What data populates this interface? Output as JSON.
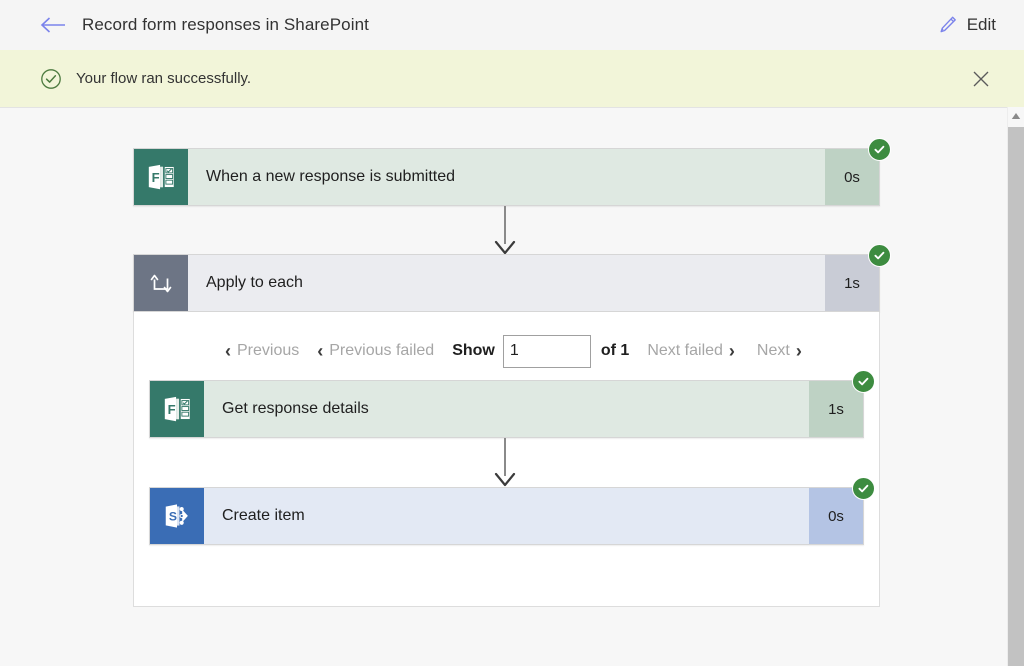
{
  "header": {
    "back_icon": "arrow-left-icon",
    "title": "Record form responses in SharePoint",
    "edit_icon": "pencil-icon",
    "edit_label": "Edit",
    "accent_color": "#7b83eb"
  },
  "banner": {
    "status_icon": "check-circle-icon",
    "message": "Your flow ran successfully.",
    "close_icon": "close-icon",
    "background_color": "#f2f5d9",
    "icon_color": "#4c7a3f"
  },
  "flow": {
    "success_badge_icon": "check-badge-icon",
    "success_badge_color": "#3d8c40",
    "steps": [
      {
        "name": "trigger-step",
        "icon": "microsoft-forms-icon",
        "label": "When a new response is submitted",
        "duration": "0s",
        "status": "succeeded",
        "theme_color": "#35796a"
      },
      {
        "name": "apply-to-each-step",
        "icon": "loop-icon",
        "label": "Apply to each",
        "duration": "1s",
        "status": "succeeded",
        "theme_color": "#6d7585"
      },
      {
        "name": "get-response-details-step",
        "icon": "microsoft-forms-icon",
        "label": "Get response details",
        "duration": "1s",
        "status": "succeeded",
        "theme_color": "#35796a"
      },
      {
        "name": "create-item-step",
        "icon": "sharepoint-icon",
        "label": "Create item",
        "duration": "0s",
        "status": "succeeded",
        "theme_color": "#3a6db5"
      }
    ]
  },
  "pager": {
    "previous_label": "Previous",
    "previous_failed_label": "Previous failed",
    "show_label": "Show",
    "iteration_value": "1",
    "iteration_placeholder": "",
    "of_label": "of 1",
    "next_failed_label": "Next failed",
    "next_label": "Next",
    "chevron_left": "‹",
    "chevron_right": "›"
  },
  "scrollbar": {
    "up_arrow_icon": "caret-up-icon"
  }
}
